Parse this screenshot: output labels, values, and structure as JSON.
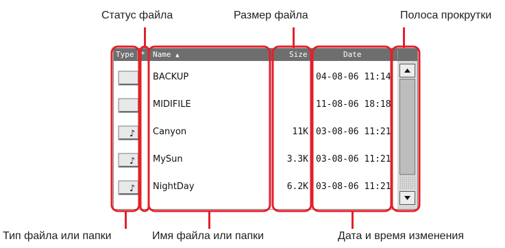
{
  "callouts": {
    "file_status": "Статус файла",
    "file_size": "Размер файла",
    "scrollbar": "Полоса прокрутки",
    "file_type": "Тип файла или папки",
    "file_name": "Имя файла или папки",
    "date_time": "Дата и время изменения"
  },
  "header": {
    "type": "Type",
    "status": "*",
    "name": "Name",
    "sort_indicator": "▲",
    "size": "Size",
    "date": "Date"
  },
  "files": [
    {
      "name": "BACKUP",
      "size": "",
      "date": "04-08-06 11:14",
      "icon": "folder-icon"
    },
    {
      "name": "MIDIFILE",
      "size": "",
      "date": "11-08-06 18:18",
      "icon": "folder-icon"
    },
    {
      "name": "Canyon",
      "size": "11K",
      "date": "03-08-06 11:21",
      "icon": "music-file-icon"
    },
    {
      "name": "MySun",
      "size": "3.3K",
      "date": "03-08-06 11:21",
      "icon": "music-file-icon"
    },
    {
      "name": "NightDay",
      "size": "6.2K",
      "date": "03-08-06 11:21",
      "icon": "music-file-icon"
    }
  ],
  "colors": {
    "highlight": "#e2202a",
    "header_bg": "#6e6e6e"
  }
}
